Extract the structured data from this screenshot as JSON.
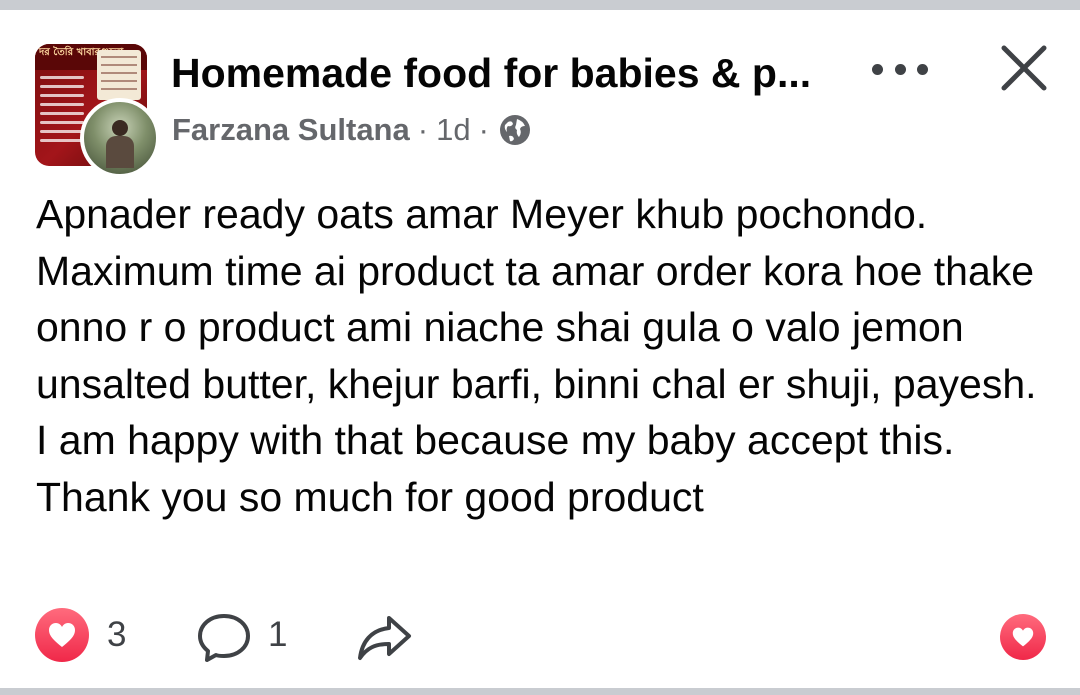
{
  "header": {
    "group_name": "Homemade food for babies & p...",
    "author": "Farzana Sultana",
    "separator": "·",
    "time": "1d",
    "privacy_icon": "globe-icon",
    "more_icon": "more-options-icon",
    "close_icon": "close-icon",
    "thumbnail_text": "দর তৈরি খাবারগুলো"
  },
  "post": {
    "text": "Apnader ready oats amar Meyer khub pochondo. Maximum time ai product ta amar order kora hoe thake onno r o product ami niache shai gula o valo jemon unsalted butter, khejur barfi, binni chal er shuji, payesh. I am happy with that because my baby accept this. Thank you so much for good product"
  },
  "footer": {
    "reaction_icon": "love-reaction-icon",
    "reaction_count": "3",
    "comment_icon": "comment-icon",
    "comment_count": "1",
    "share_icon": "share-icon",
    "react_button_icon": "love-icon"
  },
  "colors": {
    "text_primary": "#050505",
    "text_secondary": "#65676b",
    "love_red": "#f02849",
    "divider": "#c9ccd1"
  }
}
